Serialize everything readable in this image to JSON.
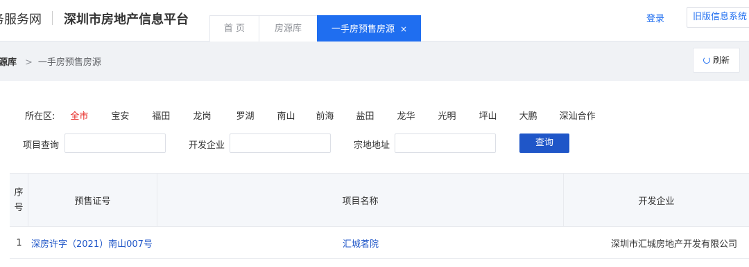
{
  "header": {
    "site_name": "务服务网",
    "platform_name": "深圳市房地产信息平台",
    "tabs": [
      {
        "label": "首 页"
      },
      {
        "label": "房源库"
      },
      {
        "label": "一手房预售房源",
        "close": "×"
      }
    ],
    "login": "登录",
    "legacy_system": "旧版信息系统"
  },
  "breadcrumb": {
    "parent": "源库",
    "separator": ">",
    "current": "一手房预售房源"
  },
  "refresh_label": "刷新",
  "filter": {
    "label": "所在区:",
    "districts": [
      "全市",
      "宝安",
      "福田",
      "龙岗",
      "罗湖",
      "南山",
      "前海",
      "盐田",
      "龙华",
      "光明",
      "坪山",
      "大鹏",
      "深汕合作"
    ],
    "selected": "全市"
  },
  "search": {
    "project_label": "项目查询",
    "project_value": "",
    "developer_label": "开发企业",
    "developer_value": "",
    "address_label": "宗地地址",
    "address_value": "",
    "button": "查询"
  },
  "table": {
    "columns": {
      "seq_top": "序",
      "seq_bottom": "号",
      "cert": "预售证号",
      "project": "项目名称",
      "developer": "开发企业"
    },
    "rows": [
      {
        "seq": "1",
        "cert": "深房许字（2021）南山007号",
        "project": "汇城茗院",
        "developer": "深圳市汇城房地产开发有限公司"
      }
    ]
  },
  "colors": {
    "primary": "#1f6ef0",
    "button": "#1f56c8",
    "active_district": "#e6231e"
  }
}
